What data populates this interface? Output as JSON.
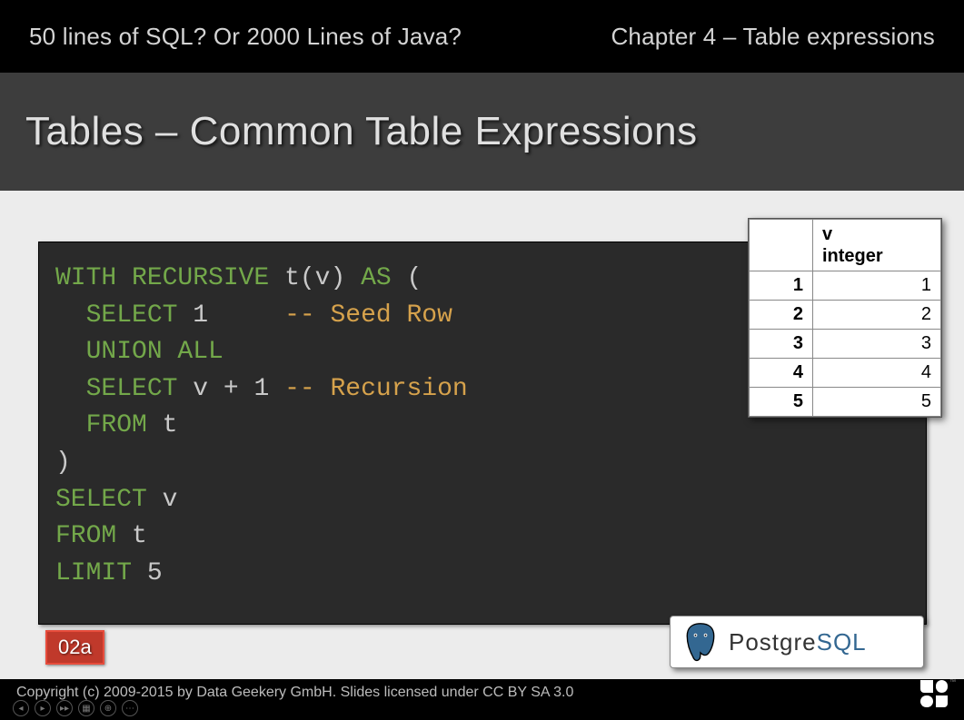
{
  "topbar": {
    "left": "50 lines of SQL? Or 2000 Lines of Java?",
    "right": "Chapter 4 – Table expressions"
  },
  "title": "Tables – Common Table Expressions",
  "code": {
    "kw_with_recursive": "WITH RECURSIVE",
    "id_tv": "t(v)",
    "kw_as": "AS",
    "punc_open": "(",
    "kw_select1": "SELECT",
    "num_1": "1",
    "cm_seed": "-- Seed Row",
    "kw_union_all": "UNION ALL",
    "kw_select2": "SELECT",
    "expr_vplus1": "v + 1",
    "cm_rec": "-- Recursion",
    "kw_from1": "FROM",
    "id_t1": "t",
    "punc_close": ")",
    "kw_select3": "SELECT",
    "id_v": "v",
    "kw_from2": "FROM",
    "id_t2": "t",
    "kw_limit": "LIMIT",
    "num_5": "5"
  },
  "result": {
    "header_col": "v\ninteger",
    "rows": [
      {
        "n": "1",
        "v": "1"
      },
      {
        "n": "2",
        "v": "2"
      },
      {
        "n": "3",
        "v": "3"
      },
      {
        "n": "4",
        "v": "4"
      },
      {
        "n": "5",
        "v": "5"
      }
    ]
  },
  "pg": {
    "name_a": "Postgre",
    "name_b": "SQL"
  },
  "slide_num": "02a",
  "footer": "Copyright (c) 2009-2015 by Data Geekery GmbH. Slides licensed under CC BY SA 3.0",
  "jooq_tm": "™"
}
